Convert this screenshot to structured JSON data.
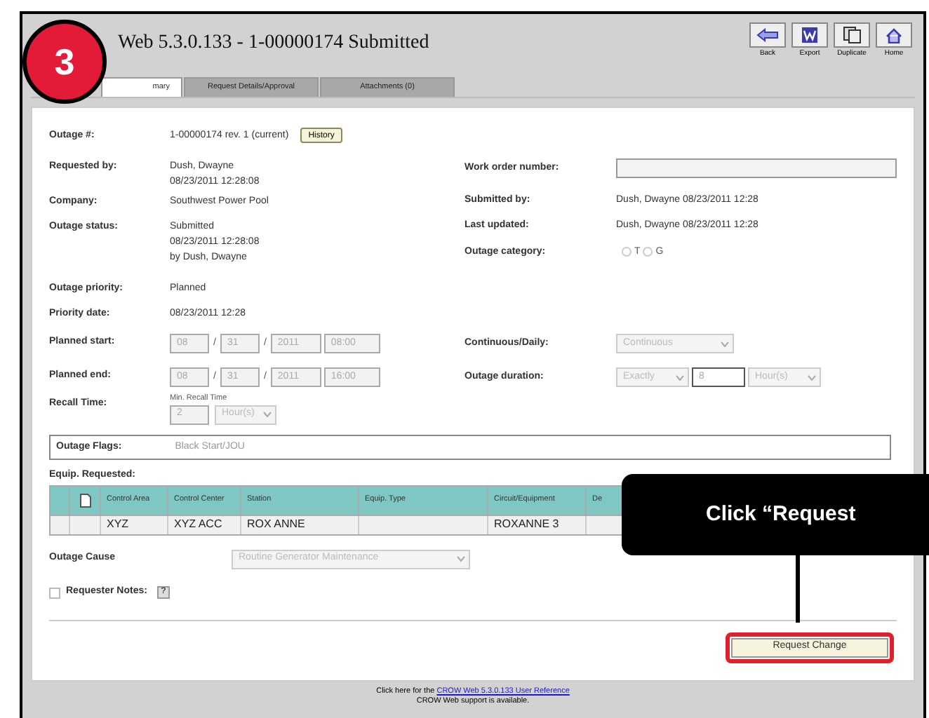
{
  "window": {
    "title": "Web 5.3.0.133 - 1-00000174 Submitted"
  },
  "toolbar": [
    {
      "label": "Back",
      "kind": "back"
    },
    {
      "label": "Export",
      "kind": "export"
    },
    {
      "label": "Duplicate",
      "kind": "duplicate"
    },
    {
      "label": "Home",
      "kind": "home"
    }
  ],
  "tabs": [
    {
      "label": "mary",
      "selected": true
    },
    {
      "label": "Request Details/Approval",
      "selected": false
    },
    {
      "label": "Attachments (0)",
      "selected": false
    }
  ],
  "rows": [
    {
      "left": {
        "label": "Outage #:",
        "kind": "text",
        "lines": [
          "1-00000174 rev. 1 (current)"
        ],
        "button": "History"
      }
    },
    {
      "left": {
        "label": "Requested by:",
        "kind": "text",
        "lines": [
          "Dush, Dwayne",
          "08/23/2011 12:28:08"
        ]
      },
      "right": [
        {
          "label": "Work order number:",
          "kind": "input"
        }
      ]
    },
    {
      "left": {
        "label": "Company:",
        "kind": "text",
        "lines": [
          "Southwest Power Pool"
        ]
      },
      "right": [
        {
          "label": "Submitted by:",
          "kind": "text",
          "value": "Dush, Dwayne 08/23/2011 12:28"
        }
      ]
    },
    {
      "left": {
        "label": "Outage status:",
        "kind": "text",
        "lines": [
          "Submitted",
          "08/23/2011 12:28:08",
          "by Dush, Dwayne"
        ]
      },
      "right": [
        {
          "label": "Last updated:",
          "kind": "text",
          "value": "Dush, Dwayne 08/23/2011 12:28"
        },
        {
          "label": "Outage category:",
          "kind": "radios",
          "options": [
            {
              "label": "T",
              "selected": false
            },
            {
              "label": "G",
              "selected": false
            }
          ]
        }
      ]
    },
    {
      "left": {
        "label": "Outage priority:",
        "kind": "text",
        "lines": [
          "Planned"
        ]
      }
    },
    {
      "left": {
        "label": "Priority date:",
        "kind": "text",
        "lines": [
          "08/23/2011 12:28"
        ]
      }
    },
    {
      "left": {
        "label": "Planned start:",
        "kind": "datetime",
        "disabled": true,
        "parts": [
          {
            "kind": "field",
            "value": "08"
          },
          {
            "kind": "sep",
            "value": "/"
          },
          {
            "kind": "field",
            "value": "31"
          },
          {
            "kind": "sep",
            "value": "/"
          },
          {
            "kind": "field",
            "value": "2011"
          },
          {
            "kind": "field",
            "value": "08:00"
          }
        ]
      },
      "right": [
        {
          "label": "Continuous/Daily:",
          "kind": "select",
          "disabled": true,
          "value": "Continuous"
        }
      ]
    },
    {
      "left": {
        "label": "Planned end:",
        "kind": "datetime",
        "disabled": true,
        "parts": [
          {
            "kind": "field",
            "value": "08"
          },
          {
            "kind": "sep",
            "value": "/"
          },
          {
            "kind": "field",
            "value": "31"
          },
          {
            "kind": "sep",
            "value": "/"
          },
          {
            "kind": "field",
            "value": "2011"
          },
          {
            "kind": "field",
            "value": "16:00"
          }
        ]
      },
      "right": [
        {
          "label": "Outage duration:",
          "kind": "duration",
          "disabled": true,
          "mode": "Exactly",
          "amount": "8",
          "unit": "Hour(s)"
        }
      ]
    },
    {
      "left": {
        "label": "Recall Time:",
        "kind": "recall",
        "disabled": true,
        "caption": "Min. Recall Time",
        "value": "2",
        "unit": "Hour(s)"
      }
    }
  ],
  "outage_flags": {
    "label": "Outage Flags:",
    "value": "Black Start/JOU"
  },
  "equipment": {
    "title": "Equip. Requested:",
    "columns": [
      "Control Area",
      "Control Center",
      "Station",
      "Equip. Type",
      "Circuit/Equipment",
      "De"
    ],
    "rows": [
      [
        "XYZ",
        "XYZ ACC",
        "ROX ANNE",
        null,
        "ROXANNE 3"
      ]
    ]
  },
  "outage_cause": {
    "label": "Outage Cause",
    "value": "Routine Generator Maintenance",
    "disabled": true
  },
  "requester_notes": {
    "label": "Requester Notes:",
    "checked": false,
    "help": "?"
  },
  "request_button": "Request Change",
  "footer": {
    "prefix": "Click here for the ",
    "link": "CROW Web 5.3.0.133 User Reference",
    "note": "CROW Web support is available."
  },
  "annotation": {
    "step": "3",
    "callout": "Click “Request"
  }
}
